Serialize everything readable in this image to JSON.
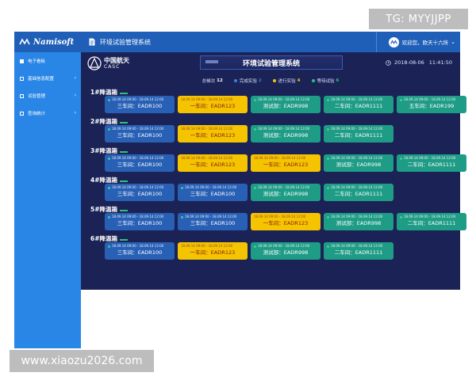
{
  "topbar": {
    "brand": "Namisoft",
    "app_title": "环境试验管理系统",
    "user_greeting": "欢迎您，欧天十六所",
    "chevron": "⌄"
  },
  "sidebar": {
    "items": [
      {
        "label": "电子看板",
        "has_arrow": false
      },
      {
        "label": "基础信息配置",
        "has_arrow": true
      },
      {
        "label": "试验管理",
        "has_arrow": true
      },
      {
        "label": "查询统计",
        "has_arrow": true
      }
    ],
    "arrow": "›"
  },
  "header": {
    "logo_cn": "中国航天",
    "logo_en": "CASC",
    "title": "环境试验管理系统",
    "date": "2018-08-06",
    "time": "11:41:50"
  },
  "summary": [
    {
      "label": "总梯次",
      "value": "12",
      "color": "#1b2356"
    },
    {
      "label": "完成实验",
      "value": "2",
      "color": "#2a86e6"
    },
    {
      "label": "进行实验",
      "value": "4",
      "color": "#f5c400"
    },
    {
      "label": "等待试验",
      "value": "6",
      "color": "#2ec27e"
    }
  ],
  "rooms": [
    {
      "name": "1#降温箱",
      "cards": [
        {
          "time": "18.09.14 09:00 - 18.09.14 12:00",
          "task": "三车间：EADR100",
          "style": "blue"
        },
        {
          "time": "18.09.14 09:00 - 18.09.14 12:00",
          "task": "一车间：EADR123",
          "style": "yellow"
        },
        {
          "time": "18.09.14 09:00 - 18.09.14 12:00",
          "task": "测试部：EADR998",
          "style": "teal"
        },
        {
          "time": "18.09.14 09:00 - 18.09.14 12:00",
          "task": "二车间：EADR1111",
          "style": "teal"
        },
        {
          "time": "18.09.14 09:00 - 18.09.14 12:00",
          "task": "五车间：EADR199",
          "style": "teal"
        }
      ]
    },
    {
      "name": "2#降温箱",
      "cards": [
        {
          "time": "18.09.14 09:00 - 18.09.14 12:00",
          "task": "三车间：EADR100",
          "style": "blue"
        },
        {
          "time": "18.09.14 09:00 - 18.09.14 12:00",
          "task": "一车间：EADR123",
          "style": "yellow"
        },
        {
          "time": "18.09.14 09:00 - 18.09.14 12:00",
          "task": "测试部：EADR998",
          "style": "teal"
        },
        {
          "time": "18.09.14 09:00 - 18.09.14 12:00",
          "task": "二车间：EADR1111",
          "style": "teal"
        }
      ]
    },
    {
      "name": "3#降温箱",
      "cards": [
        {
          "time": "18.09.14 09:00 - 18.09.14 12:00",
          "task": "三车间：EADR100",
          "style": "blue"
        },
        {
          "time": "18.09.14 09:00 - 18.09.14 12:00",
          "task": "一车间：EADR123",
          "style": "yellow"
        },
        {
          "time": "18.09.14 09:00 - 18.09.14 12:00",
          "task": "一车间：EADR123",
          "style": "yellow"
        },
        {
          "time": "18.09.14 09:00 - 18.09.14 12:00",
          "task": "测试部：EADR998",
          "style": "teal"
        },
        {
          "time": "18.09.14 09:00 - 18.09.14 12:00",
          "task": "二车间：EADR1111",
          "style": "teal"
        }
      ]
    },
    {
      "name": "4#降温箱",
      "cards": [
        {
          "time": "18.09.14 09:00 - 18.09.14 12:00",
          "task": "三车间：EADR100",
          "style": "blue"
        },
        {
          "time": "18.09.14 09:00 - 18.09.14 12:00",
          "task": "三车间：EADR100",
          "style": "blue"
        },
        {
          "time": "18.09.14 09:00 - 18.09.14 12:00",
          "task": "测试部：EADR998",
          "style": "teal"
        },
        {
          "time": "18.09.14 09:00 - 18.09.14 12:00",
          "task": "二车间：EADR1111",
          "style": "teal"
        }
      ]
    },
    {
      "name": "5#降温箱",
      "cards": [
        {
          "time": "18.09.14 09:00 - 18.09.14 12:00",
          "task": "三车间：EADR100",
          "style": "blue"
        },
        {
          "time": "18.09.14 09:00 - 18.09.14 12:00",
          "task": "三车间：EADR100",
          "style": "blue"
        },
        {
          "time": "18.09.14 09:00 - 18.09.14 12:00",
          "task": "一车间：EADR123",
          "style": "yellow"
        },
        {
          "time": "18.09.14 09:00 - 18.09.14 12:00",
          "task": "测试部：EADR998",
          "style": "teal"
        },
        {
          "time": "18.09.14 09:00 - 18.09.14 12:00",
          "task": "二车间：EADR1111",
          "style": "teal"
        }
      ]
    },
    {
      "name": "6#降温箱",
      "cards": [
        {
          "time": "18.09.14 09:00 - 18.09.14 12:00",
          "task": "三车间：EADR100",
          "style": "blue"
        },
        {
          "time": "18.09.14 09:00 - 18.09.14 12:00",
          "task": "一车间：EADR123",
          "style": "yellow"
        },
        {
          "time": "18.09.14 09:00 - 18.09.14 12:00",
          "task": "测试部：EADR998",
          "style": "teal"
        },
        {
          "time": "18.09.14 09:00 - 18.09.14 12:00",
          "task": "二车间：EADR1111",
          "style": "teal"
        }
      ]
    }
  ],
  "watermarks": {
    "tg": "TG: MYYJJPP",
    "site": "www.xiaozu2026.com"
  },
  "colors": {
    "topbar": "#1f5fb8",
    "sidebar": "#2a86e6",
    "dashboard_bg": "#1b2356",
    "card_blue": "#2860b5",
    "card_teal": "#1f9c86",
    "card_yellow": "#f5c400"
  },
  "icons": {
    "brand": "namisoft-logo-icon",
    "doc": "document-icon",
    "avatar": "user-avatar-icon",
    "clock": "clock-icon",
    "casc": "casc-logo-icon"
  }
}
